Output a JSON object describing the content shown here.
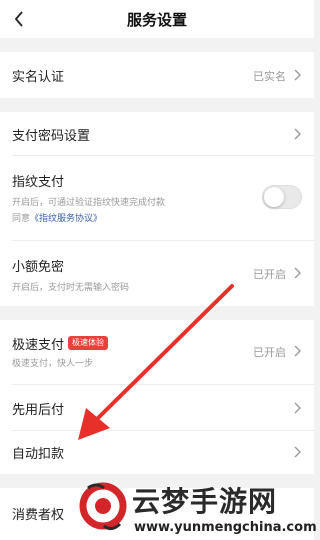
{
  "header": {
    "title": "服务设置",
    "back_icon": "chevron-left-icon"
  },
  "rows": {
    "realname": {
      "label": "实名认证",
      "value": "已实名"
    },
    "paypwd": {
      "label": "支付密码设置"
    },
    "fingerprint": {
      "label": "指纹支付",
      "desc": "开启后，可通过验证指纹快速完成付款",
      "agree_prefix": "同意",
      "agree_link": "《指纹服务协议》",
      "enabled": false
    },
    "nopwd": {
      "label": "小额免密",
      "value": "已开启",
      "desc": "开启后，支付时无需输入密码"
    },
    "fastpay": {
      "label": "极速支付",
      "badge": "极速体验",
      "value": "已开启",
      "desc": "极速支付，快人一步"
    },
    "paylater": {
      "label": "先用后付"
    },
    "autodeduct": {
      "label": "自动扣款"
    },
    "consumer": {
      "label": "消费者权"
    }
  },
  "watermark": {
    "title": "云梦手游网",
    "url": "www.yunmengchina.com"
  },
  "colors": {
    "accent": "#e8403a",
    "link": "#3b5fa8",
    "background": "#f2f2f2"
  }
}
